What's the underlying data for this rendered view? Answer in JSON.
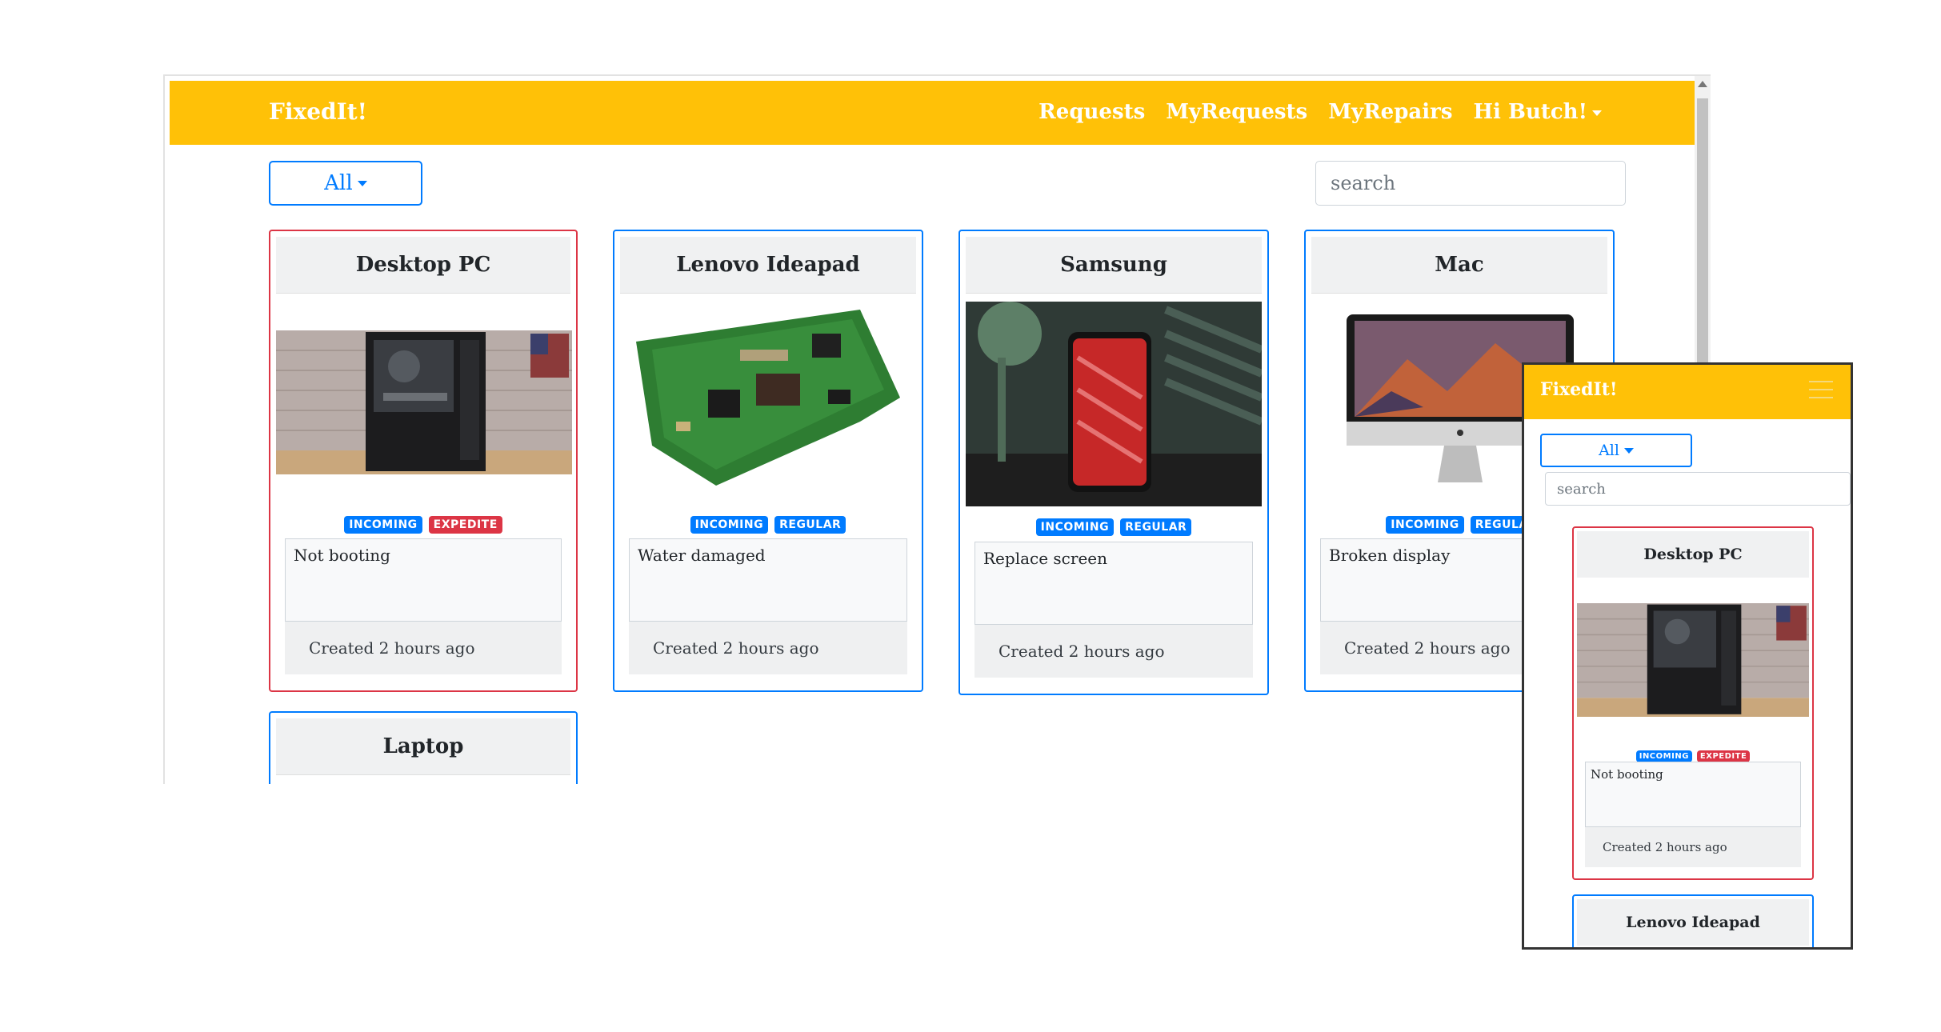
{
  "app": {
    "brand": "FixedIt!"
  },
  "nav": {
    "links": [
      "Requests",
      "MyRequests",
      "MyRepairs"
    ],
    "user_menu": "Hi Butch!"
  },
  "filter": {
    "selected": "All"
  },
  "search": {
    "placeholder": "search"
  },
  "cards": [
    {
      "title": "Desktop PC",
      "image": "desktop-pc-image",
      "badges": [
        "INCOMING",
        "EXPEDITE"
      ],
      "description": "Not booting",
      "created": "Created 2 hours ago"
    },
    {
      "title": "Lenovo Ideapad",
      "image": "motherboard-image",
      "badges": [
        "INCOMING",
        "REGULAR"
      ],
      "description": "Water damaged",
      "created": "Created 2 hours ago"
    },
    {
      "title": "Samsung",
      "image": "smartphone-image",
      "badges": [
        "INCOMING",
        "REGULAR"
      ],
      "description": "Replace screen",
      "created": "Created 2 hours ago"
    },
    {
      "title": "Mac",
      "image": "imac-image",
      "badges": [
        "INCOMING",
        "REGULA"
      ],
      "description": "Broken display",
      "created": "Created 2 hours ago"
    },
    {
      "title": "Laptop"
    }
  ],
  "mobile": {
    "brand": "FixedIt!",
    "filter": "All",
    "search_placeholder": "search",
    "cards": [
      {
        "title": "Desktop PC",
        "badges": [
          "INCOMING",
          "EXPEDITE"
        ],
        "description": "Not booting",
        "created": "Created 2 hours ago"
      },
      {
        "title": "Lenovo Ideapad"
      }
    ]
  },
  "colors": {
    "navbar": "#ffc107",
    "primary": "#007bff",
    "danger": "#dc3545"
  }
}
